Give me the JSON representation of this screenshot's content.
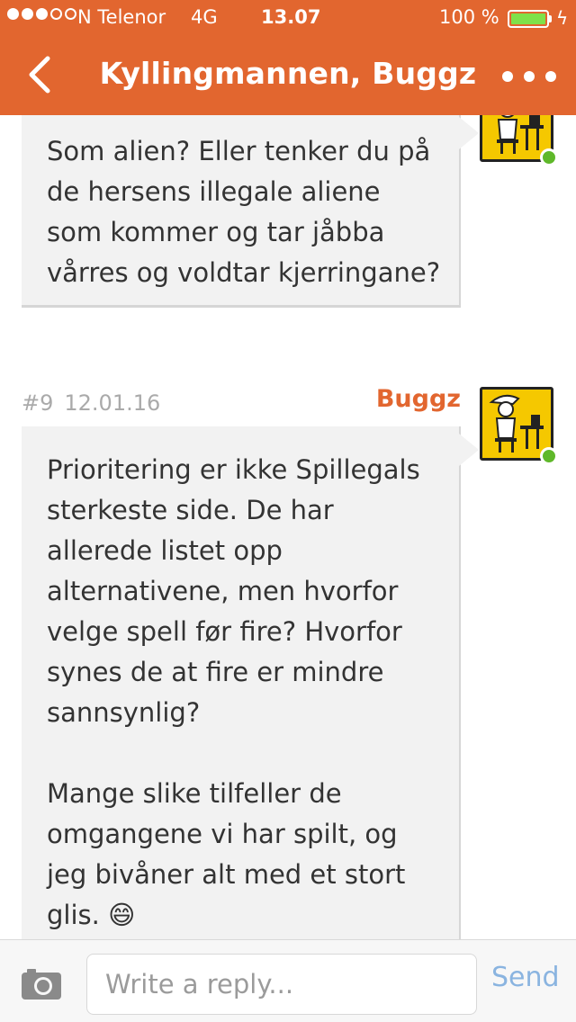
{
  "status_bar": {
    "carrier": "N Telenor",
    "network": "4G",
    "time": "13.07",
    "battery_percent": "100 %",
    "battery_level": 1.0,
    "signal_bars_filled": 3,
    "signal_bars_total": 5
  },
  "nav": {
    "title": "Kyllingmannen, Buggz",
    "back_icon": "chevron-left-icon",
    "more_icon": "more-horizontal-icon"
  },
  "posts": [
    {
      "body": "Som alien? Eller tenker du på\nde hersens illegale aliene\nsom kommer og tar jåbba\nvårres og voldtar kjerringane?"
    },
    {
      "number": "#9",
      "date": "12.01.16",
      "author": "Buggz",
      "body": "Prioritering er ikke Spillegals\nsterkeste side. De har\nallerede listet opp\nalternativene, men hvorfor\nvelge spell før fire? Hvorfor\nsynes de at fire er mindre\nsannsynlig?\n\nMange slike tilfeller de\nomgangene vi har spilt, og\njeg bivåner alt med et stort\nglis. 😄"
    }
  ],
  "reply": {
    "placeholder": "Write a reply...",
    "value": "",
    "send_label": "Send",
    "camera_icon": "camera-icon"
  },
  "colors": {
    "brand": "#e2662f",
    "bubble_bg": "#f2f2f2",
    "online": "#5fb82a",
    "send_disabled": "#8ab4e0"
  }
}
